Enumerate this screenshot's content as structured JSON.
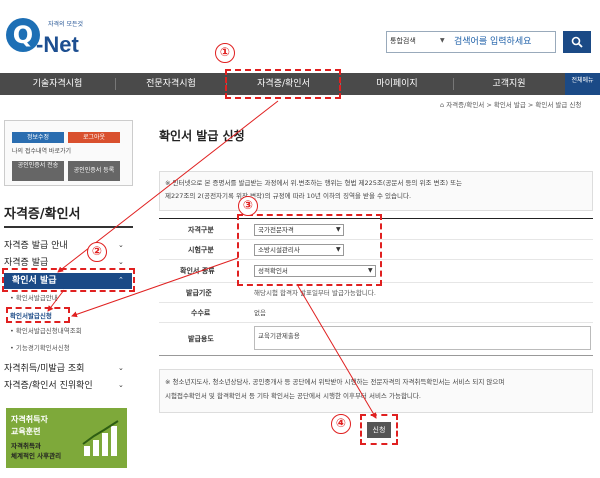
{
  "header": {
    "logo_letter": "Q",
    "logo_small": "자격의 모든것",
    "logo_name": "-Net",
    "search_category": "통합검색",
    "search_placeholder": "검색어를 입력하세요"
  },
  "nav": {
    "items": [
      "기술자격시험",
      "전문자격시험",
      "자격증/확인서",
      "마이페이지",
      "고객지원"
    ],
    "all_menu": "전체메뉴"
  },
  "sidebar": {
    "buttons": [
      "정보수정",
      "로그아웃"
    ],
    "history_link": "나의 접수내역 바로가기",
    "cert_buttons": [
      "공인인증서 전송",
      "공인인증서 등록"
    ],
    "title": "자격증/확인서",
    "menu": [
      {
        "label": "자격증 발급 안내",
        "caret": "⌄"
      },
      {
        "label": "자격증 발급",
        "caret": "⌄"
      },
      {
        "label": "확인서 발급",
        "caret": "⌃"
      }
    ],
    "submenu": [
      "확인서발급안내",
      "확인서발급신청",
      "확인서발급신청내역조회",
      "기능경기확인서신청"
    ],
    "menu2": [
      {
        "label": "자격취득/미발급 조회",
        "caret": "⌄"
      },
      {
        "label": "자격증/확인서 진위확인",
        "caret": "⌄"
      }
    ],
    "banner": {
      "line1": "자격취득자",
      "line2": "교육훈련",
      "line3": "자격취득과",
      "line4": "체계적인 사후관리"
    }
  },
  "breadcrumb": "자격증/확인서 > 확인서 발급 > 확인서 발급 신청",
  "page_title": "확인서 발급 신청",
  "notice1": {
    "line1": "※ 인터넷으로 본 증명서를 발급받는 과정에서 위.변조하는 행위는 형법 제225조(공문서 등의 위조 변조) 또는",
    "line2": "제227조의 2(공전자기록 위작.변작)의 규정에 따라 10년 이하의 징역을 받을 수 있습니다."
  },
  "form": {
    "labels": [
      "자격구분",
      "시험구분",
      "확인서 종류",
      "발급기준",
      "수수료",
      "발급용도"
    ],
    "selects": [
      "국가전문자격",
      "소방시설관리사",
      "성적확인서"
    ],
    "standard": "해당시험 합격자 발표일부터 발급가능합니다.",
    "fee": "없음",
    "purpose": "교육기관제출용"
  },
  "notice2": {
    "line1": "※ 청소년지도사, 청소년상담사, 공인중개사 등 공단에서 위탁받아 시행하는 전문자격의 자격취득확인서는 서비스 되지 않으며",
    "line2": "시험접수확인서 및 합격확인서 등 기타 확인서는 공단에서 시행한 이후부터 서비스 가능합니다."
  },
  "apply_label": "신청",
  "markers": [
    "①",
    "②",
    "③",
    "④"
  ],
  "colors": {
    "brand": "#1b4a86",
    "annotation": "#e02020",
    "nav": "#4a4a4a",
    "banner": "#7ea93a"
  }
}
